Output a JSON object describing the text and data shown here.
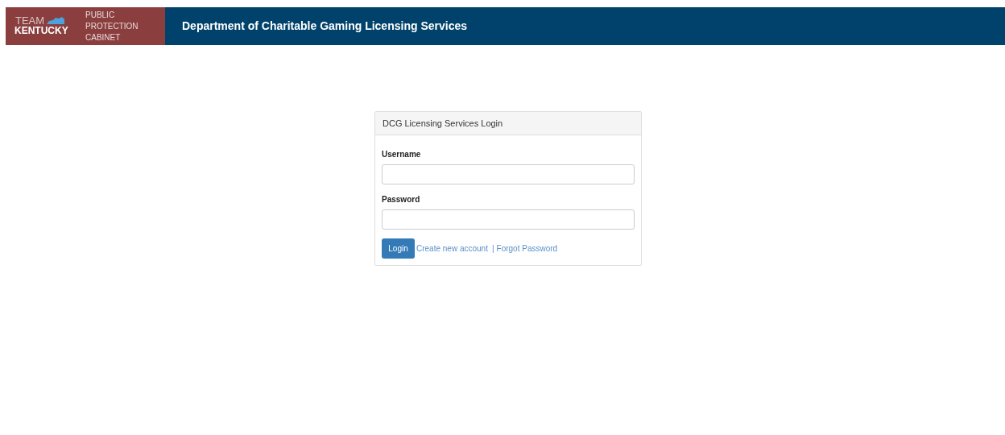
{
  "header": {
    "logo": {
      "line_1": "TEAM",
      "line_2": "KENTUCKY"
    },
    "cabinet": [
      "PUBLIC",
      "PROTECTION",
      "CABINET"
    ],
    "title": "Department of Charitable Gaming Licensing Services"
  },
  "login": {
    "heading": "DCG Licensing Services Login",
    "fields": [
      {
        "label": "Username"
      },
      {
        "label": "Password"
      }
    ],
    "button": "Login",
    "links": [
      "Create new account",
      "Forgot Password"
    ],
    "separator": "|"
  }
}
